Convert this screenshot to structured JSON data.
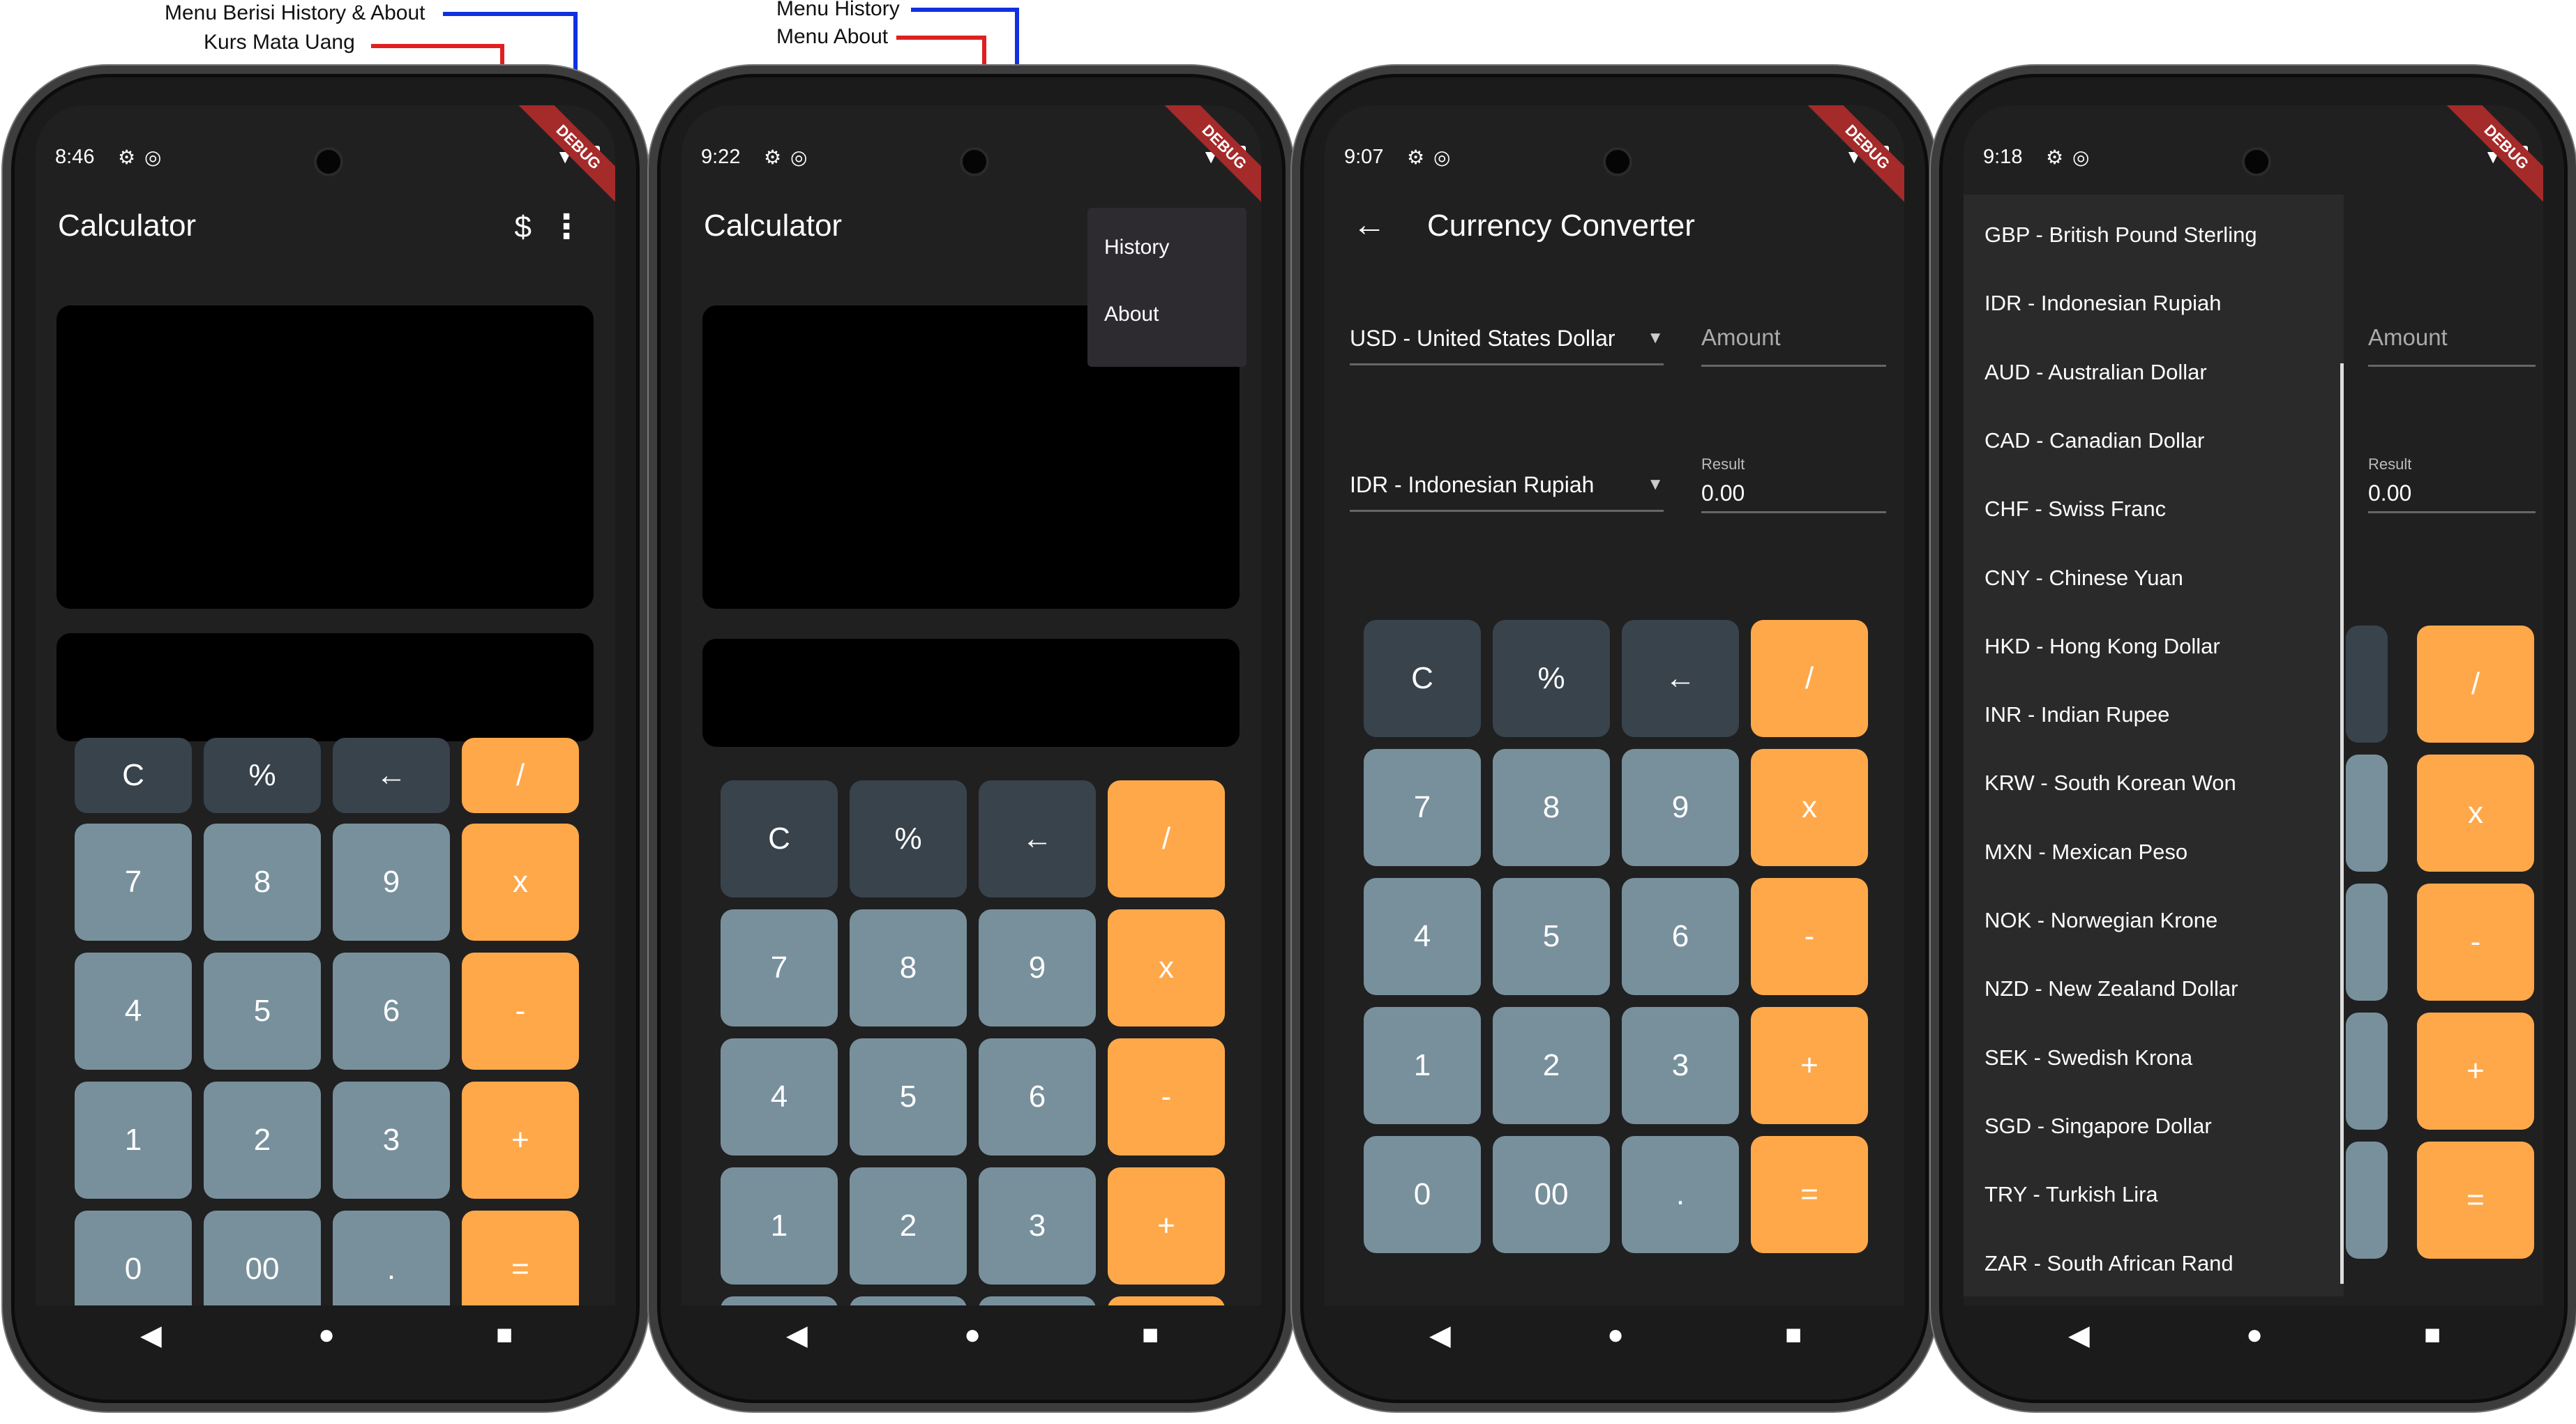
{
  "annotations": {
    "menu_history_about": "Menu Berisi History & About",
    "kurs_mata_uang": "Kurs Mata Uang",
    "menu_history": "Menu History",
    "menu_about": "Menu About"
  },
  "colors": {
    "operator_key": "#39434c",
    "number_key": "#78909c",
    "accent_key": "#ffa84a",
    "app_background": "#202020",
    "annotation_red": "#e02020",
    "annotation_blue": "#1030e0"
  },
  "screens": [
    {
      "time": "8:46",
      "title": "Calculator",
      "actions": {
        "currency_icon": "$",
        "menu_icon": "⋮"
      }
    },
    {
      "time": "9:22",
      "title": "Calculator",
      "menu": {
        "history": "History",
        "about": "About"
      }
    },
    {
      "time": "9:07",
      "title": "Currency Converter",
      "from_currency": "USD - United States Dollar",
      "amount_placeholder": "Amount",
      "to_currency": "IDR - Indonesian Rupiah",
      "result_label": "Result",
      "result_value": "0.00"
    },
    {
      "time": "9:18",
      "amount_placeholder": "Amount",
      "result_label": "Result",
      "result_value": "0.00",
      "currency_options": [
        "GBP - British Pound Sterling",
        "IDR - Indonesian Rupiah",
        "AUD - Australian Dollar",
        "CAD - Canadian Dollar",
        "CHF - Swiss Franc",
        "CNY - Chinese Yuan",
        "HKD - Hong Kong Dollar",
        "INR - Indian Rupee",
        "KRW - South Korean Won",
        "MXN - Mexican Peso",
        "NOK - Norwegian Krone",
        "NZD - New Zealand Dollar",
        "SEK - Swedish Krona",
        "SGD - Singapore Dollar",
        "TRY - Turkish Lira",
        "ZAR - South African Rand"
      ]
    }
  ],
  "keypad": {
    "row1": [
      "C",
      "%",
      "←",
      "/"
    ],
    "row2": [
      "7",
      "8",
      "9",
      "x"
    ],
    "row3": [
      "4",
      "5",
      "6",
      "-"
    ],
    "row4": [
      "1",
      "2",
      "3",
      "+"
    ],
    "row5": [
      "0",
      "00",
      ".",
      "="
    ]
  },
  "debug_banner": "DEBUG"
}
